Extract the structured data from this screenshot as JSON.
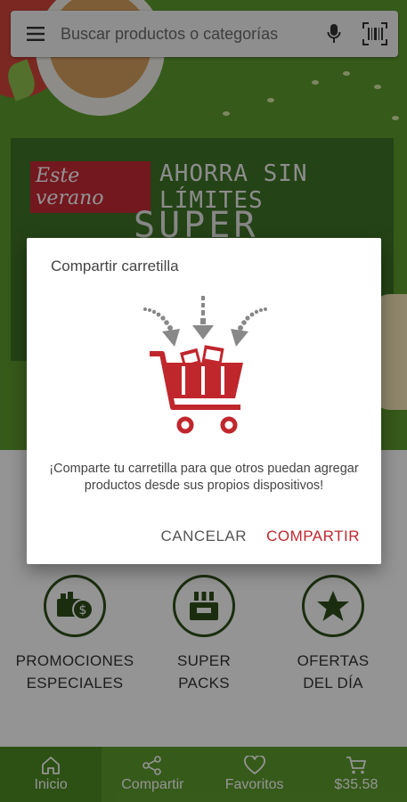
{
  "search": {
    "placeholder": "Buscar productos o categorías"
  },
  "hero": {
    "tag": "Este verano",
    "headline": "AHORRA SIN LÍMITES",
    "sub": "SUPER OFERTAS"
  },
  "categories": [
    {
      "label": "PROMOCIONES\nESPECIALES",
      "icon": "promotions-icon"
    },
    {
      "label": "SUPER\nPACKS",
      "icon": "packs-icon"
    },
    {
      "label": "OFERTAS\nDEL DÍA",
      "icon": "star-icon"
    }
  ],
  "nav": {
    "items": [
      {
        "label": "Inicio",
        "icon": "home-icon"
      },
      {
        "label": "Compartir",
        "icon": "share-icon"
      },
      {
        "label": "Favoritos",
        "icon": "heart-icon"
      },
      {
        "label": "$35.58",
        "icon": "cart-icon"
      }
    ],
    "active_index": 0
  },
  "dialog": {
    "title": "Compartir carretilla",
    "message": "¡Comparte tu carretilla para que otros puedan agregar productos desde sus propios dispositivos!",
    "cancel_label": "CANCELAR",
    "confirm_label": "COMPARTIR",
    "illustration": "shared-cart-icon"
  },
  "colors": {
    "brand_green": "#5d9c2e",
    "accent_red": "#c0272d",
    "dark_green": "#2f4f1b"
  }
}
